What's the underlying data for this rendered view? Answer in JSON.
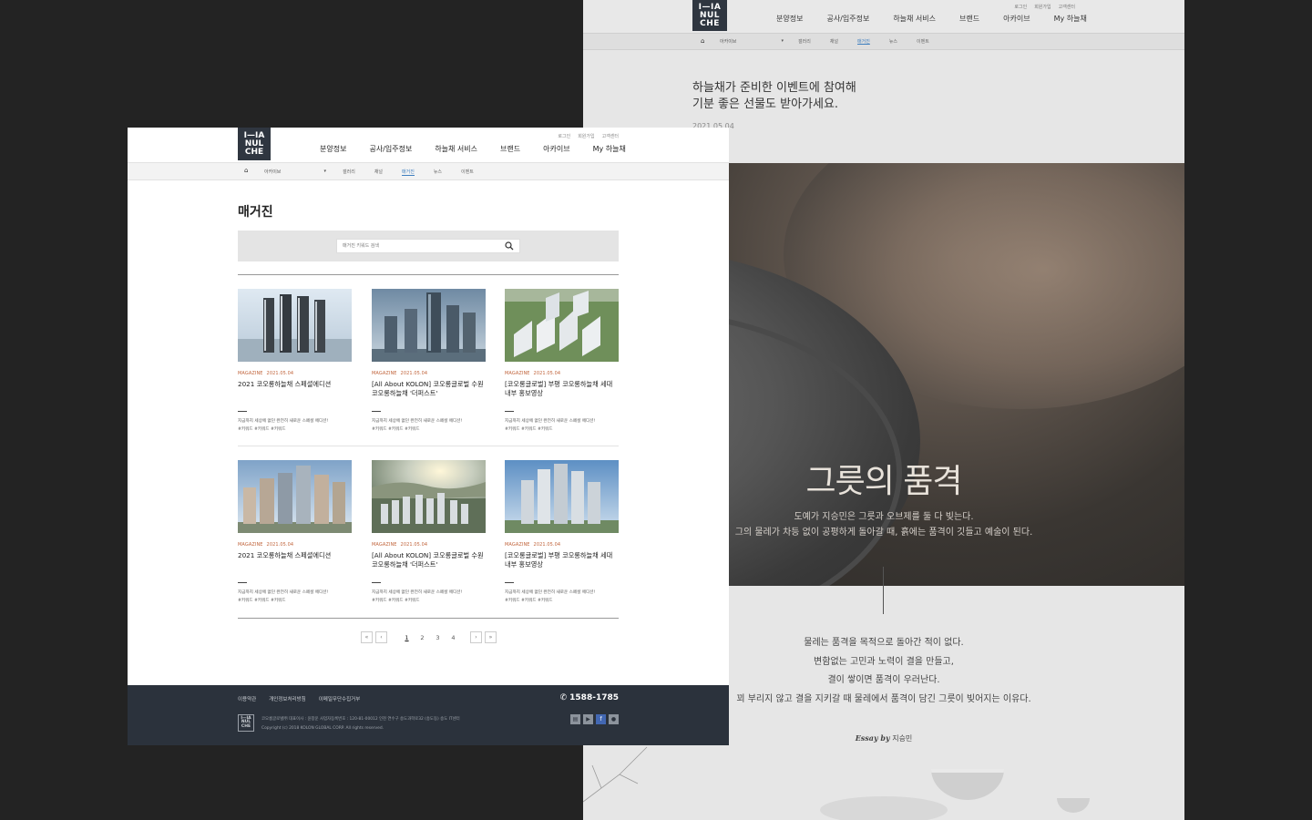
{
  "brand": {
    "logo_lines": [
      "I—IA",
      "NUL",
      "CHE"
    ]
  },
  "back_page": {
    "util_links": [
      "로그인",
      "회원가입",
      "고객센터"
    ],
    "gnb": [
      "분양정보",
      "공사/입주정보",
      "하늘채 서비스",
      "브랜드",
      "아카이브",
      "My 하늘채"
    ],
    "lnb_select": "아카이브",
    "lnb_subs": [
      "갤러리",
      "채널",
      "매거진",
      "뉴스",
      "이벤트"
    ],
    "lnb_active": "매거진",
    "intro_line1": "하늘채가 준비한 이벤트에 참여해",
    "intro_line2": "기분 좋은 선물도 받아가세요.",
    "date": "2021.05.04",
    "hero_title": "그릇의 품격",
    "hero_line1": "도예가 지승민은 그릇과 오브제를 둘 다 빚는다.",
    "hero_line2": "그의 물레가 차등 없이 공평하게 돌아갈 때, 흙에는 품격이 깃들고 예술이 된다.",
    "essay_lines": [
      "물레는 품격을 목적으로 돌아간 적이 없다.",
      "변함없는 고민과 노력이 결을 만들고,",
      "결이 쌓이면 품격이 우러난다.",
      "꾀 부리지 않고 결을 지키갈 때 물레에서 품격이 담긴 그릇이 빚어지는 이유다."
    ],
    "essay_by_label": "Essay by",
    "essay_by_name": "지승민"
  },
  "front_page": {
    "util_links": [
      "로그인",
      "회원가입",
      "고객센터"
    ],
    "gnb": [
      "분양정보",
      "공사/입주정보",
      "하늘채 서비스",
      "브랜드",
      "아카이브",
      "My 하늘채"
    ],
    "lnb_select": "아카이브",
    "lnb_subs": [
      "갤러리",
      "채널",
      "매거진",
      "뉴스",
      "이벤트"
    ],
    "lnb_active": "매거진",
    "page_title": "매거진",
    "search_placeholder": "매거진 키워드 검색",
    "cards": [
      {
        "category": "MAGAZINE",
        "date": "2021.05.04",
        "title": "2021 코오롱하늘채 스페셜에디션",
        "desc": "지금까지 세상에 없던 완전히 새로운 스페셜 에디션!",
        "tags": "#키워드 #키워드 #키워드"
      },
      {
        "category": "MAGAZINE",
        "date": "2021.05.04",
        "title": "[All About KOLON] 코오롱글로벌 수원 코오롱하늘채 '더퍼스트'",
        "desc": "지금까지 세상에 없던 완전히 새로운 스페셜 에디션!",
        "tags": "#키워드 #키워드 #키워드"
      },
      {
        "category": "MAGAZINE",
        "date": "2021.05.04",
        "title": "[코오롱글로벌] 부평 코오롱하늘채 세대 내부 홍보영상",
        "desc": "지금까지 세상에 없던 완전히 새로운 스페셜 에디션!",
        "tags": "#키워드 #키워드 #키워드"
      },
      {
        "category": "MAGAZINE",
        "date": "2021.05.04",
        "title": "2021 코오롱하늘채 스페셜에디션",
        "desc": "지금까지 세상에 없던 완전히 새로운 스페셜 에디션!",
        "tags": "#키워드 #키워드 #키워드"
      },
      {
        "category": "MAGAZINE",
        "date": "2021.05.04",
        "title": "[All About KOLON] 코오롱글로벌 수원 코오롱하늘채 '더퍼스트'",
        "desc": "지금까지 세상에 없던 완전히 새로운 스페셜 에디션!",
        "tags": "#키워드 #키워드 #키워드"
      },
      {
        "category": "MAGAZINE",
        "date": "2021.05.04",
        "title": "[코오롱글로벌] 부평 코오롱하늘채 세대 내부 홍보영상",
        "desc": "지금까지 세상에 없던 완전히 새로운 스페셜 에디션!",
        "tags": "#키워드 #키워드 #키워드"
      }
    ],
    "pager": {
      "first": "«",
      "prev": "‹",
      "pages": [
        "1",
        "2",
        "3",
        "4"
      ],
      "current": "1",
      "next": "›",
      "last": "»"
    },
    "footer": {
      "links": [
        "이용약관",
        "개인정보처리방침",
        "이메일무단수집거부"
      ],
      "phone": "1588-1785",
      "addr_line1": "코오롱글로벌㈜   대표이사 : 윤창운   사업자등록번호 : 120-81-00012   인천 연수구 송도과학로32 (송도동) 송도 IT센터",
      "copyright": "Copyright (c) 2018 KOLON GLOBAL CORP. All rights reserved.",
      "sns": [
        "blog-icon",
        "youtube-icon",
        "facebook-icon",
        "kakao-icon"
      ]
    }
  },
  "colors": {
    "footer_bg": "#2b323c",
    "accent_orange": "#c0633a",
    "active_blue": "#3f7fbf",
    "logo_bg": "#2f3640"
  }
}
